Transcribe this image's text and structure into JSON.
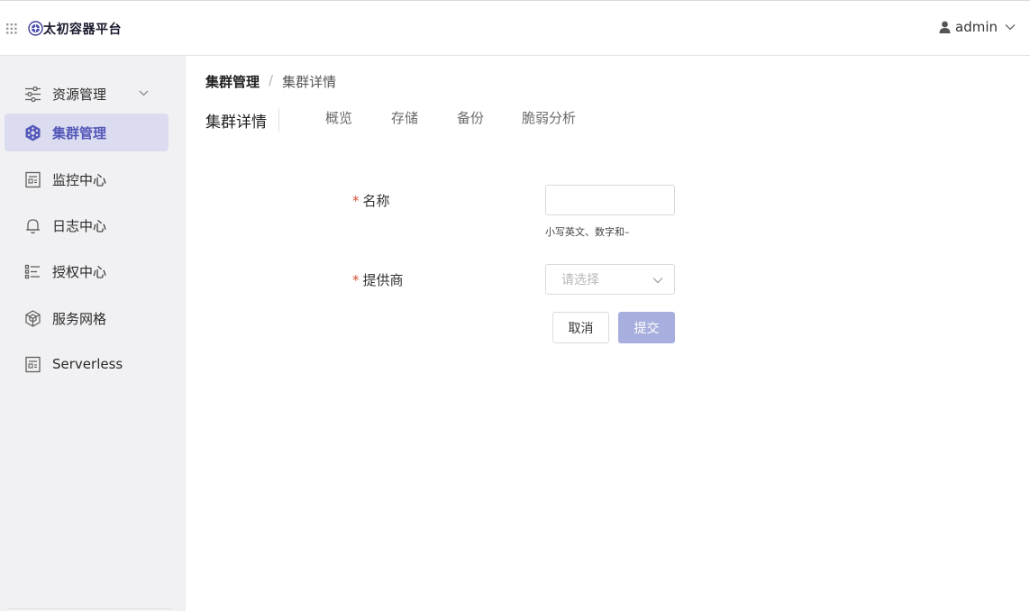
{
  "app": {
    "brand": "太初容器平台"
  },
  "header": {
    "user_name": "admin"
  },
  "colors": {
    "accent": "#5458b8",
    "active_bg": "#dcdcf0",
    "submit_bg": "#a8aedd",
    "required": "#d4503a"
  },
  "sidebar": {
    "items": [
      {
        "label": "资源管理",
        "icon": "sliders-icon"
      },
      {
        "label": "集群管理",
        "icon": "cluster-icon",
        "active": true
      },
      {
        "label": "监控中心",
        "icon": "monitor-icon"
      },
      {
        "label": "日志中心",
        "icon": "bell-icon"
      },
      {
        "label": "授权中心",
        "icon": "list-icon"
      },
      {
        "label": "服务网格",
        "icon": "mesh-icon"
      },
      {
        "label": "Serverless",
        "icon": "serverless-icon"
      }
    ]
  },
  "breadcrumb": {
    "root": "集群管理",
    "separator": "/",
    "current": "集群详情"
  },
  "page": {
    "title": "集群详情"
  },
  "tabs": [
    {
      "label": "概览"
    },
    {
      "label": "存储"
    },
    {
      "label": "备份"
    },
    {
      "label": "脆弱分析"
    }
  ],
  "form": {
    "name": {
      "required_mark": "*",
      "label": "名称",
      "value": "",
      "hint": "小写英文、数字和–"
    },
    "provider": {
      "required_mark": "*",
      "label": "提供商",
      "placeholder": "请选择"
    },
    "cancel_label": "取消",
    "submit_label": "提交"
  }
}
